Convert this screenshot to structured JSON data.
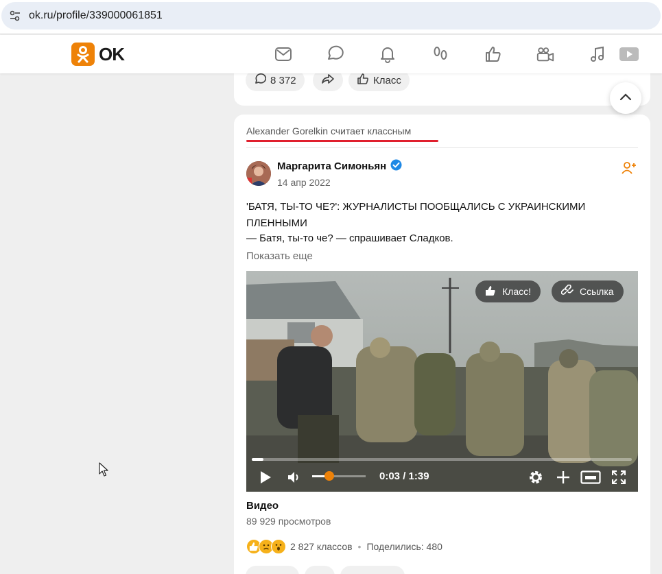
{
  "browser": {
    "url": "ok.ru/profile/339000061851"
  },
  "header": {
    "logo_text": "OK",
    "brand_color": "#ee8208",
    "nav_icons": [
      "mail-icon",
      "chat-icon",
      "bell-icon",
      "footprints-icon",
      "like-icon",
      "video-camera-icon",
      "music-icon",
      "video-play-icon"
    ]
  },
  "prev_post": {
    "comments_count": "8 372",
    "share_icon": "share-icon",
    "like_label": "Класс"
  },
  "post": {
    "liked_by": "Alexander Gorelkin считает классным",
    "author": "Маргарита Симоньян",
    "date": "14 апр 2022",
    "title": "'БАТЯ, ТЫ-ТО ЧЕ?': ЖУРНАЛИСТЫ ПООБЩАЛИСЬ С УКРАИНСКИМИ ПЛЕННЫМИ",
    "subtitle": "— Батя, ты-то че? — спрашивает Сладков.",
    "show_more": "Показать еще",
    "video": {
      "like_button": "Класс!",
      "link_button": "Ссылка",
      "time": "0:03 / 1:39",
      "progress_fraction": 0.03
    },
    "video_label": "Видео",
    "views": "89 929 просмотров",
    "reactions_count": "2 827 классов",
    "shared": "Поделились: 480"
  }
}
